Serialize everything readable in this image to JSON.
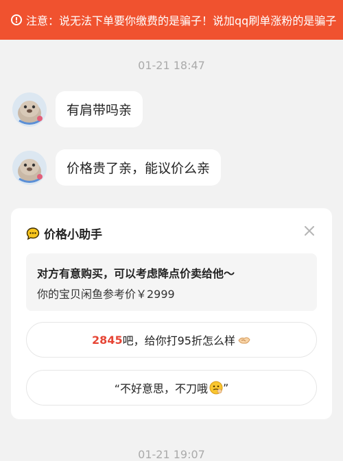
{
  "warning": {
    "icon": "exclamation-icon",
    "text": "注意：说无法下单要你缴费的是骗子！说加qq刷单涨粉的是骗子",
    "color": "#f0522f"
  },
  "timestamps": [
    "01-21 18:47",
    "01-21 19:07"
  ],
  "messages": [
    {
      "text": "有肩带吗亲"
    },
    {
      "text": "价格贵了亲，能议价么亲"
    }
  ],
  "price_helper": {
    "title": "价格小助手",
    "close_icon": "close-icon",
    "tip_line1": "对方有意购买，可以考虑降点价卖给他～",
    "tip_line2": "你的宝贝闲鱼参考价￥2999",
    "option1": {
      "price": "2845",
      "text": "吧，给你打95折怎么样"
    },
    "option2": {
      "text": "“不好意思，不刀哦",
      "close_quote": "”"
    },
    "accent_color": "#e64535"
  }
}
